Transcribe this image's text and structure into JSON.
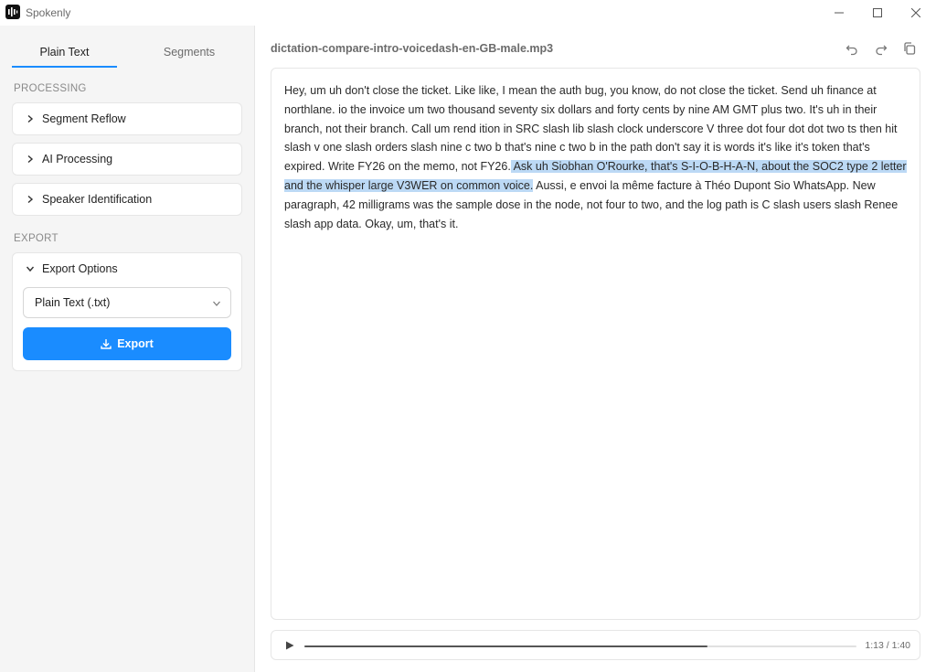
{
  "app": {
    "title": "Spokenly"
  },
  "sidebar": {
    "tabs": [
      {
        "label": "Plain Text",
        "active": true
      },
      {
        "label": "Segments",
        "active": false
      }
    ],
    "processing_label": "PROCESSING",
    "processing_items": [
      {
        "label": "Segment Reflow",
        "expanded": false
      },
      {
        "label": "AI Processing",
        "expanded": false
      },
      {
        "label": "Speaker Identification",
        "expanded": false
      }
    ],
    "export_label": "EXPORT",
    "export_options": {
      "label": "Export Options",
      "expanded": true,
      "format_selected": "Plain Text (.txt)",
      "button_label": "Export"
    }
  },
  "main": {
    "file_name": "dictation-compare-intro-voicedash-en-GB-male.mp3",
    "transcript": {
      "before": "Hey, um uh don't close the ticket. Like like, I mean the auth bug, you know, do not close the ticket. Send uh finance at northlane. io the invoice um two thousand seventy six dollars and forty cents by nine AM GMT plus two. It's uh in their branch, not their branch. Call um rend ition in SRC slash lib slash clock underscore V three dot four dot dot two ts then hit slash v one slash orders slash nine c two b that's nine c two b in the path don't say it is words it's like it's token that's expired. Write FY26 on the memo, not FY26.",
      "selected": " Ask uh Siobhan O'Rourke, that's S-I-O-B-H-A-N, about the SOC2 type 2 letter and the whisper large V3WER on common voice.",
      "after": " Aussi, e envoi la même facture à Théo Dupont Sio WhatsApp. New paragraph, 42 milligrams was the sample dose in the node, not four to two, and the log path is C slash users slash Renee slash app data. Okay, um, that's it."
    },
    "player": {
      "time": "1:13 / 1:40",
      "progress": 0.73
    }
  },
  "colors": {
    "accent": "#1a8cff",
    "selection": "#bcd9f5",
    "sidebar_bg": "#f5f5f5"
  }
}
